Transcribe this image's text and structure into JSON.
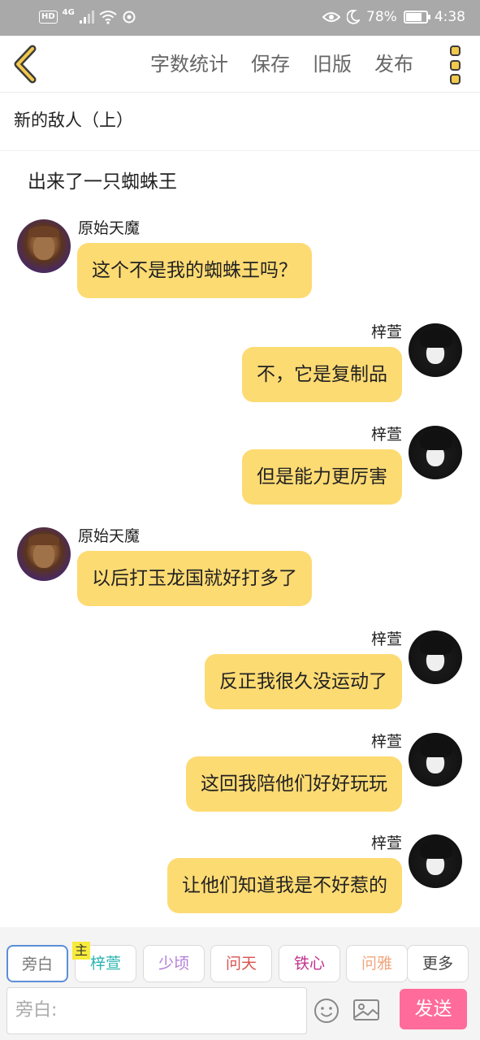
{
  "status_bar": {
    "network_badge": "HD",
    "network_type": "4G",
    "battery_percent": "78%",
    "battery_level": 0.78,
    "time": "4:38"
  },
  "toolbar": {
    "word_count_label": "字数统计",
    "save_label": "保存",
    "old_version_label": "旧版",
    "publish_label": "发布"
  },
  "chapter": {
    "title": "新的敌人（上）"
  },
  "narration": "出来了一只蜘蛛王",
  "messages": [
    {
      "side": "left",
      "sender": "原始天魔",
      "text": "这个不是我的蜘蛛王吗？"
    },
    {
      "side": "right",
      "sender": "梓萱",
      "text": "不，它是复制品"
    },
    {
      "side": "right",
      "sender": "梓萱",
      "text": "但是能力更厉害"
    },
    {
      "side": "left",
      "sender": "原始天魔",
      "text": "以后打玉龙国就好打多了"
    },
    {
      "side": "right",
      "sender": "梓萱",
      "text": "反正我很久没运动了"
    },
    {
      "side": "right",
      "sender": "梓萱",
      "text": "这回我陪他们好好玩玩"
    },
    {
      "side": "right",
      "sender": "梓萱",
      "text": "让他们知道我是不好惹的"
    }
  ],
  "roles": {
    "main_badge": "主",
    "items": [
      {
        "label": "旁白",
        "color": "#777777"
      },
      {
        "label": "梓萱",
        "color": "#2bb5b0"
      },
      {
        "label": "少顷",
        "color": "#b07bd6"
      },
      {
        "label": "问天",
        "color": "#d9534f"
      },
      {
        "label": "铁心",
        "color": "#c0338f"
      },
      {
        "label": "问雅",
        "color": "#f0a77e"
      },
      {
        "label": "更多",
        "color": "#444444"
      }
    ]
  },
  "composer": {
    "placeholder": "旁白:",
    "send_label": "发送"
  },
  "colors": {
    "bubble": "#fddb73",
    "accent": "#ff6b9a",
    "status_bar": "#a9a9a9"
  }
}
